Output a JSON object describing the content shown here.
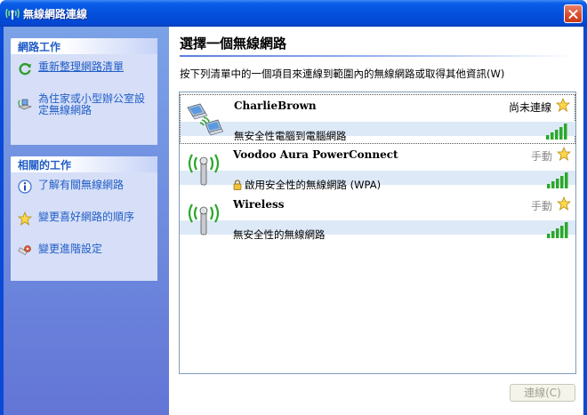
{
  "window": {
    "title": "無線網路連線"
  },
  "sidebar": {
    "network_tasks": {
      "heading": "網路工作",
      "items": [
        {
          "label": "重新整理網路清單",
          "icon": "refresh-icon"
        },
        {
          "label_line1": "為住家或小型辦公室設",
          "label_line2": "定無線網路",
          "icon": "setup-wizard-icon"
        }
      ]
    },
    "related_tasks": {
      "heading": "相關的工作",
      "items": [
        {
          "label": "了解有關無線網路",
          "icon": "info-icon"
        },
        {
          "label": "變更喜好網路的順序",
          "icon": "star-icon"
        },
        {
          "label": "變更進階設定",
          "icon": "settings-icon"
        }
      ]
    }
  },
  "main": {
    "title": "選擇一個無線網路",
    "instruction": "按下列清單中的一個項目來連線到範圍內的無線網路或取得其他資訊(W)",
    "networks": [
      {
        "name": "CharlieBrown",
        "status": "尚未連線",
        "security": "無安全性電腦到電腦網路",
        "icon": "adhoc-computers-icon",
        "signal_bars": 5
      },
      {
        "name": "Voodoo Aura PowerConnect",
        "status": "手動",
        "security": "啟用安全性的無線網路 (WPA)",
        "icon": "wireless-antenna-icon",
        "signal_bars": 5
      },
      {
        "name": "Wireless",
        "status": "手動",
        "security": "無安全性的無線網路",
        "icon": "wireless-antenna-icon",
        "signal_bars": 5
      }
    ],
    "connect_label": "連線(C)"
  },
  "colors": {
    "titlebar": "#0450dc",
    "sidebar": "#6f8ddf",
    "link": "#215dc6",
    "signal": "#2aa82a"
  }
}
